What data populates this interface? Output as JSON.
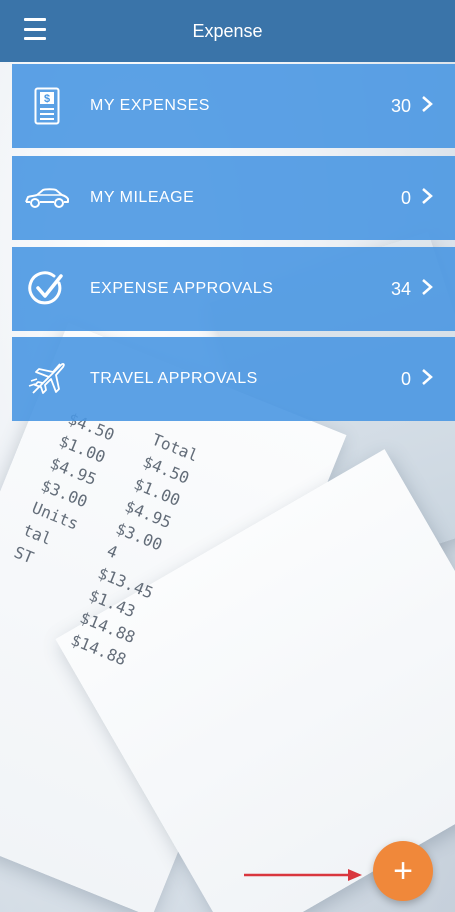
{
  "header": {
    "title": "Expense"
  },
  "menu": [
    {
      "label": "MY EXPENSES",
      "count": "30",
      "icon": "receipt-dollar-icon"
    },
    {
      "label": "MY MILEAGE",
      "count": "0",
      "icon": "car-icon"
    },
    {
      "label": "EXPENSE APPROVALS",
      "count": "34",
      "icon": "check-circle-icon"
    },
    {
      "label": "TRAVEL APPROVALS",
      "count": "0",
      "icon": "airplane-icon"
    }
  ],
  "background": {
    "receipt_lines_left": "$4.50\n$1.00\n$4.95\n$3.00\nUnits\ntal\nST",
    "receipt_lines_right": "Total\n$4.50\n$1.00\n$4.95\n$3.00\n4\n$13.45\n$1.43\n$14.88\n$14.88"
  },
  "fab": {
    "symbol": "+"
  },
  "colors": {
    "header": "#3a74a9",
    "tile": "#4a97e2",
    "fab": "#f0883a",
    "arrow": "#d9363e"
  }
}
